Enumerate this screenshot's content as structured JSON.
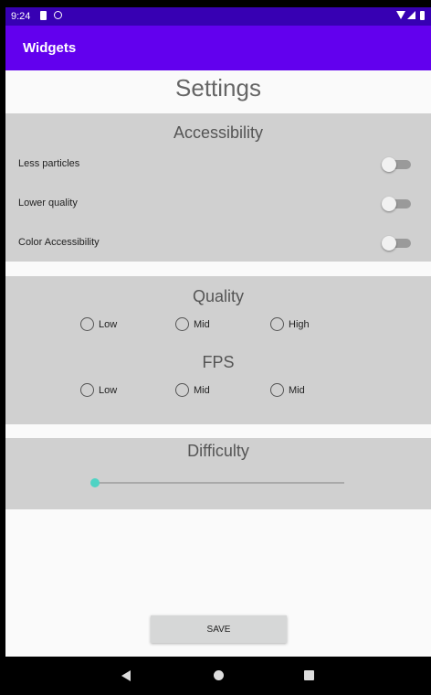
{
  "status_bar": {
    "time": "9:24"
  },
  "app_bar": {
    "title": "Widgets"
  },
  "page": {
    "title": "Settings"
  },
  "accessibility": {
    "title": "Accessibility",
    "toggles": [
      {
        "label": "Less particles",
        "on": false
      },
      {
        "label": "Lower quality",
        "on": false
      },
      {
        "label": "Color Accessibility",
        "on": false
      }
    ]
  },
  "quality": {
    "title": "Quality",
    "options": [
      "Low",
      "Mid",
      "High"
    ],
    "selected": null
  },
  "fps": {
    "title": "FPS",
    "options": [
      "Low",
      "Mid",
      "Mid"
    ],
    "selected": null
  },
  "difficulty": {
    "title": "Difficulty",
    "value_fraction": 0,
    "accent": "#4fd3c4"
  },
  "save_button": {
    "label": "SAVE"
  },
  "colors": {
    "status_bar": "#3700b3",
    "app_bar": "#6200ee",
    "panel": "#d0d0d0",
    "background": "#fafafa"
  },
  "icons": {
    "status": [
      "sd-card-icon",
      "sync-icon",
      "wifi-icon",
      "signal-icon",
      "battery-icon"
    ],
    "nav": [
      "back-icon",
      "home-icon",
      "recents-icon"
    ]
  }
}
